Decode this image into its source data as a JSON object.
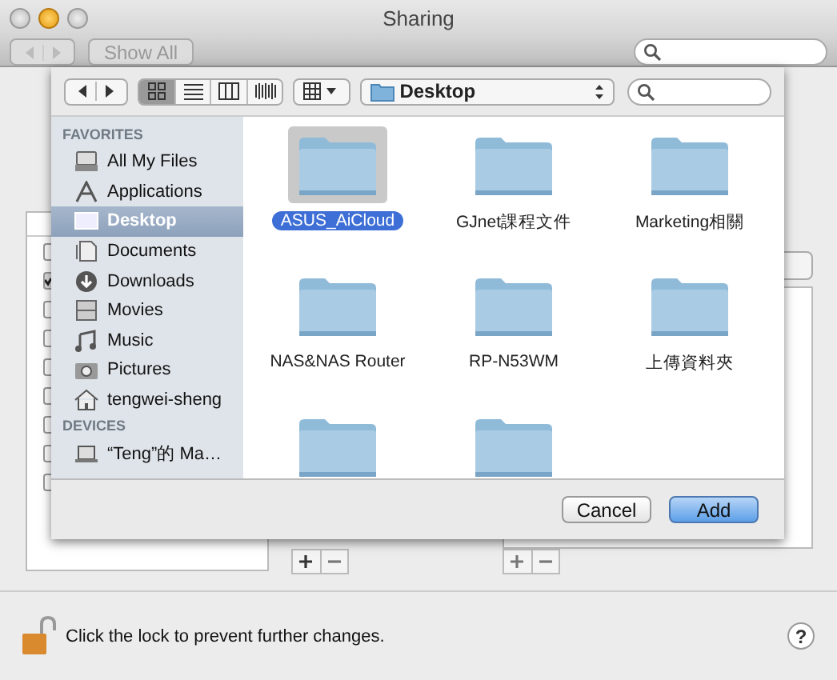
{
  "window": {
    "title": "Sharing",
    "show_all": "Show All"
  },
  "services": {
    "rows": [
      {
        "checked": false
      },
      {
        "checked": true
      },
      {
        "checked": false
      },
      {
        "checked": false
      },
      {
        "checked": false
      },
      {
        "checked": false
      },
      {
        "checked": false
      },
      {
        "checked": false
      },
      {
        "checked": false
      }
    ]
  },
  "sheet": {
    "view_modes": [
      {
        "selected": true
      },
      {
        "selected": false
      },
      {
        "selected": false
      },
      {
        "selected": false
      }
    ],
    "location": "Desktop",
    "sidebar": [
      {
        "heading": "FAVORITES",
        "items": [
          {
            "label": "All My Files",
            "selected": false
          },
          {
            "label": "Applications",
            "selected": false
          },
          {
            "label": "Desktop",
            "selected": true
          },
          {
            "label": "Documents",
            "selected": false
          },
          {
            "label": "Downloads",
            "selected": false
          },
          {
            "label": "Movies",
            "selected": false
          },
          {
            "label": "Music",
            "selected": false
          },
          {
            "label": "Pictures",
            "selected": false
          },
          {
            "label": "tengwei-sheng",
            "selected": false
          }
        ]
      },
      {
        "heading": "DEVICES",
        "items": [
          {
            "label": "“Teng”的 Ma…",
            "selected": false
          }
        ]
      }
    ],
    "folders": [
      {
        "label": "ASUS_AiCloud",
        "selected": true
      },
      {
        "label": "GJnet課程文件",
        "selected": false
      },
      {
        "label": "Marketing相關",
        "selected": false
      },
      {
        "label": "NAS&NAS Router",
        "selected": false
      },
      {
        "label": "RP-N53WM",
        "selected": false
      },
      {
        "label": "上傳資料夾",
        "selected": false
      },
      {
        "selected": false
      },
      {
        "selected": false
      }
    ],
    "buttons": [
      {
        "label": "Cancel",
        "kind": "cancel"
      },
      {
        "label": "Add",
        "kind": "default"
      }
    ]
  },
  "footer": {
    "lock_text": "Click the lock to prevent further changes.",
    "help": "?"
  }
}
